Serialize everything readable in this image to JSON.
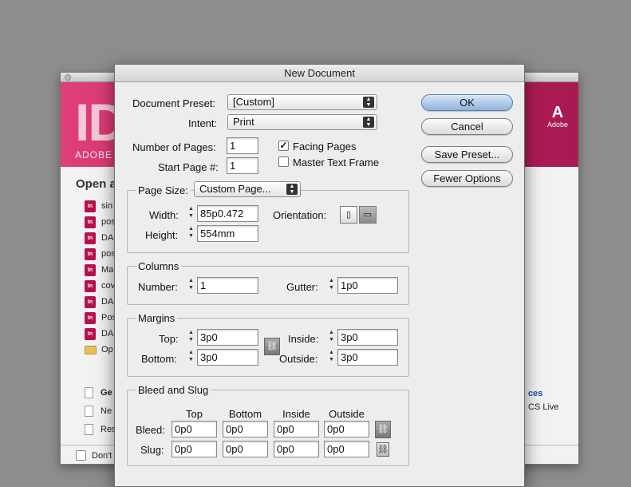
{
  "welcome": {
    "logo_text": "ID",
    "brand": "ADOBE",
    "adobe_logo": "Adobe",
    "open_heading": "Open a",
    "recent_files": [
      "sin",
      "pos",
      "DA",
      "pos",
      "Ma",
      "cov",
      "DA",
      "Pos",
      "DA",
      "Op"
    ],
    "lower_items": [
      "Ge",
      "Ne",
      "Res"
    ],
    "right_link": "ces",
    "right_sub": "CS Live",
    "dont_show": "Don't"
  },
  "dialog": {
    "title": "New Document",
    "document_preset_label": "Document Preset:",
    "document_preset_value": "[Custom]",
    "intent_label": "Intent:",
    "intent_value": "Print",
    "num_pages_label": "Number of Pages:",
    "num_pages_value": "1",
    "start_page_label": "Start Page #:",
    "start_page_value": "1",
    "facing_pages_label": "Facing Pages",
    "facing_pages_checked": true,
    "master_text_frame_label": "Master Text Frame",
    "master_text_frame_checked": false,
    "page_size_label": "Page Size:",
    "page_size_value": "Custom Page...",
    "width_label": "Width:",
    "width_value": "85p0.472",
    "height_label": "Height:",
    "height_value": "554mm",
    "orientation_label": "Orientation:",
    "columns_title": "Columns",
    "number_label": "Number:",
    "number_value": "1",
    "gutter_label": "Gutter:",
    "gutter_value": "1p0",
    "margins_title": "Margins",
    "top_label": "Top:",
    "top_value": "3p0",
    "bottom_label": "Bottom:",
    "bottom_value": "3p0",
    "inside_label": "Inside:",
    "inside_value": "3p0",
    "outside_label": "Outside:",
    "outside_value": "3p0",
    "bleed_slug_title": "Bleed and Slug",
    "col_headers": [
      "Top",
      "Bottom",
      "Inside",
      "Outside"
    ],
    "bleed_label": "Bleed:",
    "bleed_values": [
      "0p0",
      "0p0",
      "0p0",
      "0p0"
    ],
    "slug_label": "Slug:",
    "slug_values": [
      "0p0",
      "0p0",
      "0p0",
      "0p0"
    ],
    "buttons": {
      "ok": "OK",
      "cancel": "Cancel",
      "save_preset": "Save Preset...",
      "fewer_options": "Fewer Options"
    }
  }
}
